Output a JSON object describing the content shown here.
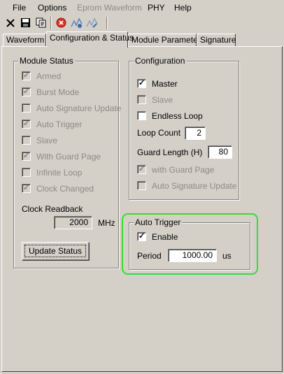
{
  "menu": [
    {
      "label": "File",
      "enabled": true
    },
    {
      "label": "Options",
      "enabled": true
    },
    {
      "label": "Eprom Waveform",
      "enabled": false
    },
    {
      "label": "PHY",
      "enabled": true
    },
    {
      "label": "Help",
      "enabled": true
    }
  ],
  "toolbar": {
    "icons": [
      "close-icon",
      "save-icon",
      "copy-icon",
      "stop-icon",
      "wave-add-icon",
      "wave-edit-icon"
    ]
  },
  "tabs": [
    {
      "label": "Waveform",
      "active": false
    },
    {
      "label": "Configuration & Status",
      "active": true
    },
    {
      "label": "Module Parameter",
      "active": false
    },
    {
      "label": "Signature",
      "active": false
    }
  ],
  "module_status": {
    "title": "Module Status",
    "items": [
      {
        "label": "Armed",
        "checked": true
      },
      {
        "label": "Burst Mode",
        "checked": true
      },
      {
        "label": "Auto Signature Update",
        "checked": false
      },
      {
        "label": "Auto Trigger",
        "checked": true
      },
      {
        "label": "Slave",
        "checked": false
      },
      {
        "label": "With Guard Page",
        "checked": true
      },
      {
        "label": "Infinite Loop",
        "checked": false
      },
      {
        "label": "Clock Changed",
        "checked": true
      }
    ],
    "clock_readback_label": "Clock Readback",
    "clock_readback_value": "2000",
    "clock_unit": "MHz",
    "update_button": "Update Status"
  },
  "configuration": {
    "title": "Configuration",
    "master": {
      "label": "Master",
      "checked": true
    },
    "slave": {
      "label": "Slave",
      "checked": false
    },
    "endless_loop": {
      "label": "Endless Loop",
      "checked": false
    },
    "loop_count_label": "Loop Count",
    "loop_count_value": "2",
    "guard_length_label": "Guard Length (H)",
    "guard_length_value": "80",
    "with_guard_page": {
      "label": "with Guard Page",
      "checked": true
    },
    "auto_signature_update": {
      "label": "Auto Signature Update",
      "checked": false
    }
  },
  "auto_trigger": {
    "title": "Auto Trigger",
    "enable": {
      "label": "Enable",
      "checked": true
    },
    "period_label": "Period",
    "period_value": "1000.00",
    "period_unit": "us"
  },
  "highlight_color": "#39d939"
}
